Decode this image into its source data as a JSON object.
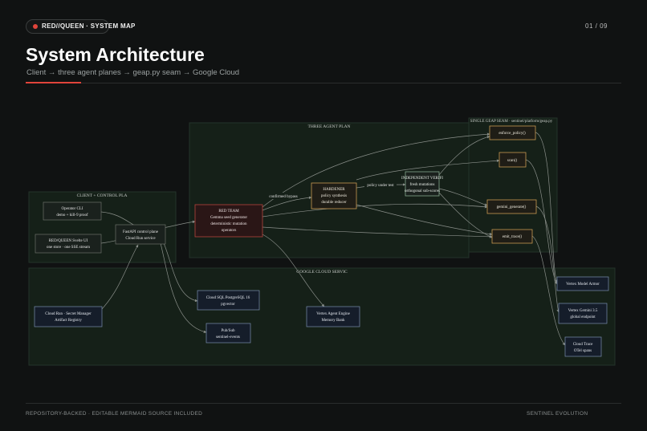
{
  "header": {
    "badge": "RED//QUEEN · SYSTEM MAP",
    "pager": "01 / 09",
    "title": "System Architecture",
    "subtitle": "Client → three agent planes → geap.py seam → Google Cloud"
  },
  "footer": {
    "left": "REPOSITORY-BACKED · EDITABLE MERMAID SOURCE INCLUDED",
    "right": "SENTINEL EVOLUTION"
  },
  "diagram": {
    "groups": {
      "agent_plane": "THREE AGENT PLAN",
      "seam": "SINGLE GEAP SEAM · sentinel/platform/geap.py",
      "client": "CLIENT + CONTROL PLA",
      "cloud": "GOOGLE CLOUD SERVIC"
    },
    "nodes": {
      "operator_cli": [
        "Operator CLI",
        "demo + kill-9 proof"
      ],
      "svelte_ui": [
        "RED/QUEEN Svelte UI",
        "one store · one SSE stream"
      ],
      "fastapi": [
        "FastAPI control plane",
        "Cloud Run service"
      ],
      "red_team": [
        "RED TEAM",
        "Gemma seed generator",
        "deterministic mutation",
        "operators"
      ],
      "hardener": [
        "HARDENER",
        "policy synthesis",
        "durable reducer"
      ],
      "verifier": [
        "INDEPENDENT VERIFI",
        "fresh mutations",
        "orthogonal sub-scores"
      ],
      "enforce_policy": [
        "enforce_policy()"
      ],
      "scan": [
        "scan()"
      ],
      "gemini_generate": [
        "gemini_generate()"
      ],
      "emit_trace": [
        "emit_trace()"
      ],
      "cloud_run": [
        "Cloud Run · Secret Manager",
        "Artifact Registry"
      ],
      "cloud_sql": [
        "Cloud SQL PostgreSQL 16",
        "pgvector"
      ],
      "pubsub": [
        "Pub/Sub",
        "sentinel-events"
      ],
      "vertex_engine": [
        "Vertex Agent Engine",
        "Memory Bank"
      ],
      "model_armor": [
        "Vertex Model Armor"
      ],
      "gemini_35": [
        "Vertex Gemini 3.5",
        "global endpoint"
      ],
      "cloud_trace": [
        "Cloud Trace",
        "OTel spans"
      ]
    },
    "edge_labels": {
      "red_to_hardener": "confirmed bypass",
      "hardener_to_verifier": "policy under test"
    },
    "colors": {
      "background": "#101212",
      "group_fill": "#152018",
      "group_stroke": "#24332a",
      "node_fill": "#1a211d",
      "node_stroke": "#6b7069",
      "red_fill": "#2a1616",
      "red_stroke": "#b5453d",
      "amber_stroke": "#c79a52",
      "green_stroke": "#84a88e",
      "blue_fill": "#151d2a",
      "blue_stroke": "#7b8fae",
      "edge": "#8a8f8a",
      "accent": "#e0443b"
    }
  }
}
